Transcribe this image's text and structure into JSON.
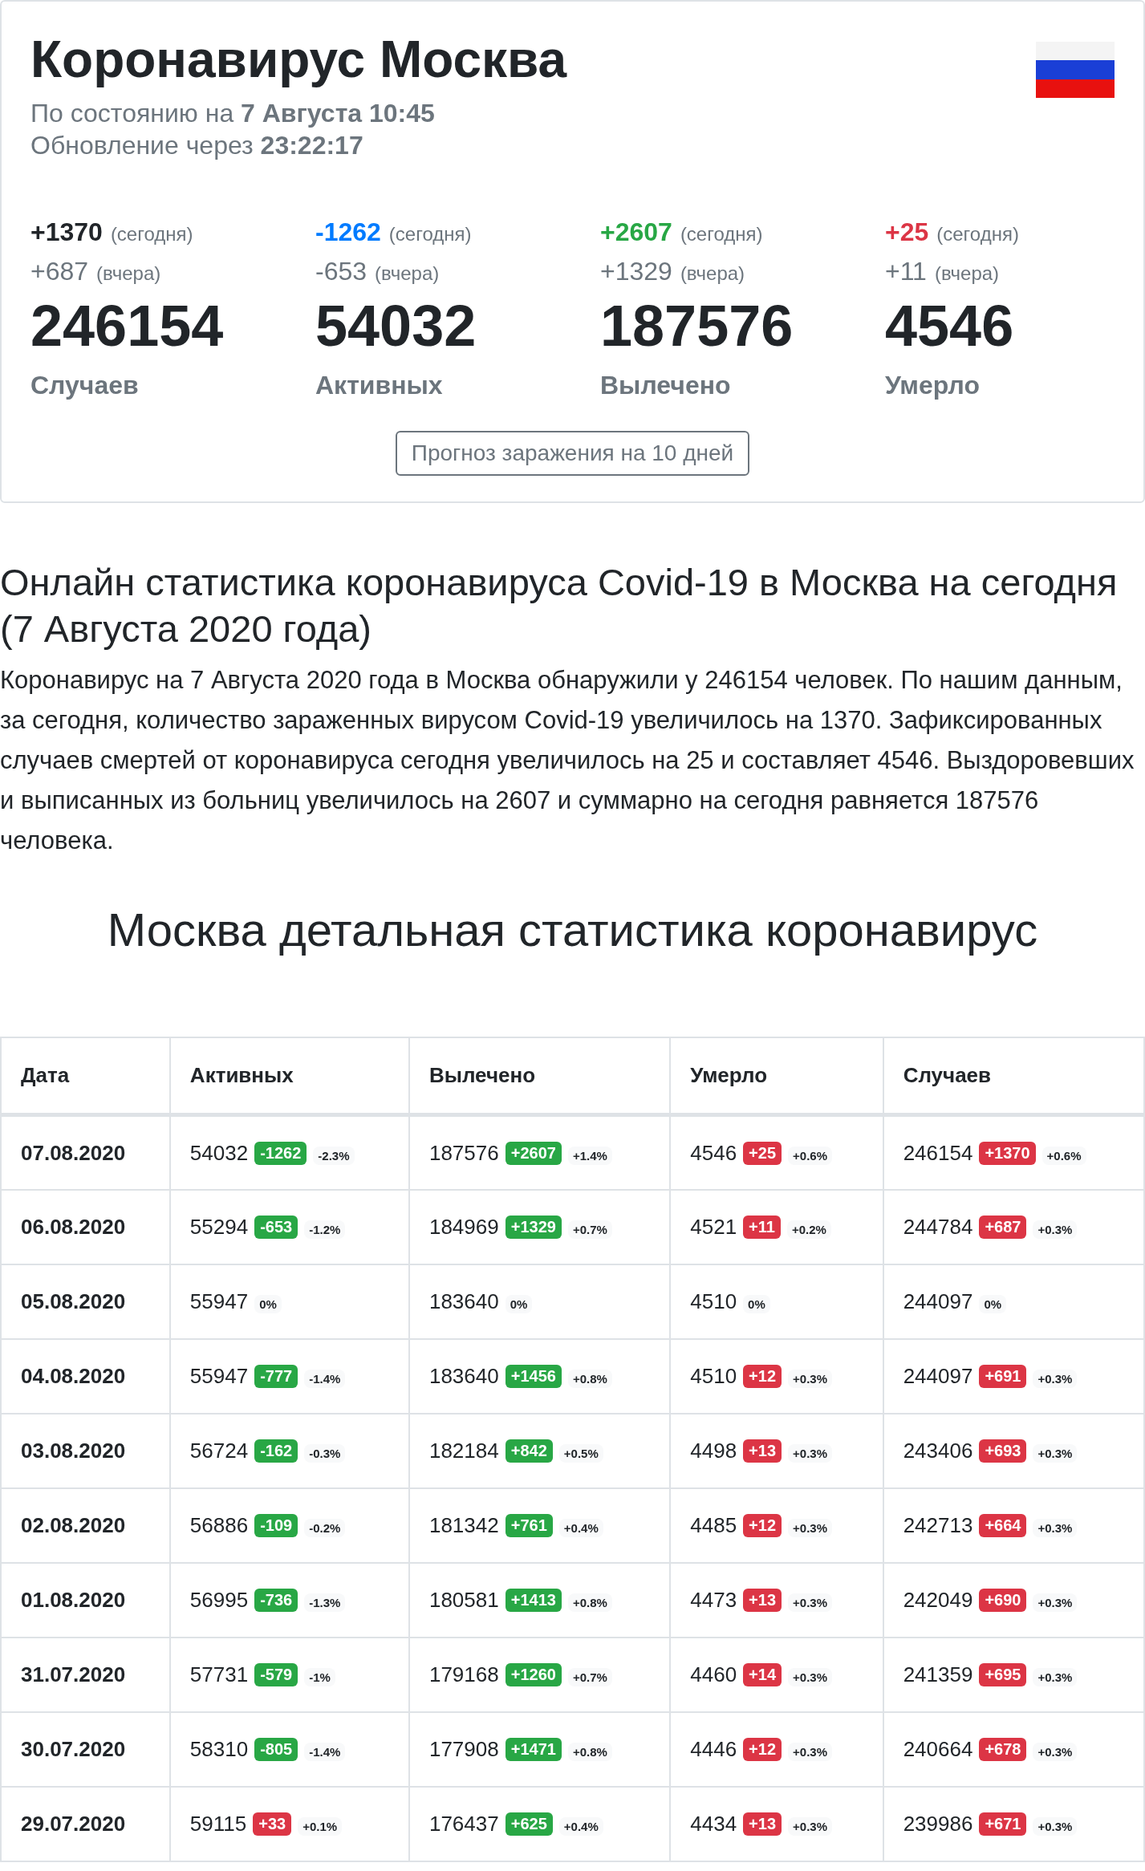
{
  "header": {
    "title": "Коронавирус Москва",
    "as_of": "По состоянию на **7 Августа 10:45**",
    "update": "Обновление через **23:22:17**"
  },
  "stats": [
    {
      "today": "+1370",
      "today_label": "(сегодня)",
      "color": "#212529",
      "yesterday": "+687",
      "yesterday_label": "(вчера)",
      "total": "246154",
      "label": "Случаев"
    },
    {
      "today": "-1262",
      "today_label": "(сегодня)",
      "color": "#007bff",
      "yesterday": "-653",
      "yesterday_label": "(вчера)",
      "total": "54032",
      "label": "Активных"
    },
    {
      "today": "+2607",
      "today_label": "(сегодня)",
      "color": "#28a745",
      "yesterday": "+1329",
      "yesterday_label": "(вчера)",
      "total": "187576",
      "label": "Вылечено"
    },
    {
      "today": "+25",
      "today_label": "(сегодня)",
      "color": "#dc3545",
      "yesterday": "+11",
      "yesterday_label": "(вчера)",
      "total": "4546",
      "label": "Умерло"
    }
  ],
  "forecast_button": "Прогноз заражения на 10 дней",
  "article": {
    "heading": "Онлайн статистика коронавируса Covid-19 в Москва на сегодня (7 Августа 2020 года)",
    "text": "Коронавирус на 7 Августа 2020 года в Москва обнаружили у 246154 человек. По нашим данным, за сегодня, количество зараженных вирусом Covid-19 увеличилось на 1370. Зафиксированных случаев смертей от коронавируса сегодня увеличилось на 25 и составляет 4546. Выздоровевших и выписанных из больниц увеличилось на 2607 и суммарно на сегодня равняется 187576 человека."
  },
  "table_heading": "Москва детальная статистика коронавирус",
  "table": {
    "columns": [
      "Дата",
      "Активных",
      "Вылечено",
      "Умерло",
      "Случаев"
    ],
    "rows": [
      {
        "cells": [
          {
            "kind": "date",
            "value": "07.08.2020"
          },
          {
            "kind": "stat",
            "value": "54032",
            "delta": "-1262",
            "color": "#28a745",
            "pct": "-2.3%"
          },
          {
            "kind": "stat",
            "value": "187576",
            "delta": "+2607",
            "color": "#28a745",
            "pct": "+1.4%"
          },
          {
            "kind": "stat",
            "value": "4546",
            "delta": "+25",
            "color": "#dc3545",
            "pct": "+0.6%"
          },
          {
            "kind": "stat",
            "value": "246154",
            "delta": "+1370",
            "color": "#dc3545",
            "pct": "+0.6%"
          }
        ]
      },
      {
        "cells": [
          {
            "kind": "date",
            "value": "06.08.2020"
          },
          {
            "kind": "stat",
            "value": "55294",
            "delta": "-653",
            "color": "#28a745",
            "pct": "-1.2%"
          },
          {
            "kind": "stat",
            "value": "184969",
            "delta": "+1329",
            "color": "#28a745",
            "pct": "+0.7%"
          },
          {
            "kind": "stat",
            "value": "4521",
            "delta": "+11",
            "color": "#dc3545",
            "pct": "+0.2%"
          },
          {
            "kind": "stat",
            "value": "244784",
            "delta": "+687",
            "color": "#dc3545",
            "pct": "+0.3%"
          }
        ]
      },
      {
        "cells": [
          {
            "kind": "date",
            "value": "05.08.2020"
          },
          {
            "kind": "stat",
            "value": "55947",
            "pct": "0%"
          },
          {
            "kind": "stat",
            "value": "183640",
            "pct": "0%"
          },
          {
            "kind": "stat",
            "value": "4510",
            "pct": "0%"
          },
          {
            "kind": "stat",
            "value": "244097",
            "pct": "0%"
          }
        ]
      },
      {
        "cells": [
          {
            "kind": "date",
            "value": "04.08.2020"
          },
          {
            "kind": "stat",
            "value": "55947",
            "delta": "-777",
            "color": "#28a745",
            "pct": "-1.4%"
          },
          {
            "kind": "stat",
            "value": "183640",
            "delta": "+1456",
            "color": "#28a745",
            "pct": "+0.8%"
          },
          {
            "kind": "stat",
            "value": "4510",
            "delta": "+12",
            "color": "#dc3545",
            "pct": "+0.3%"
          },
          {
            "kind": "stat",
            "value": "244097",
            "delta": "+691",
            "color": "#dc3545",
            "pct": "+0.3%"
          }
        ]
      },
      {
        "cells": [
          {
            "kind": "date",
            "value": "03.08.2020"
          },
          {
            "kind": "stat",
            "value": "56724",
            "delta": "-162",
            "color": "#28a745",
            "pct": "-0.3%"
          },
          {
            "kind": "stat",
            "value": "182184",
            "delta": "+842",
            "color": "#28a745",
            "pct": "+0.5%"
          },
          {
            "kind": "stat",
            "value": "4498",
            "delta": "+13",
            "color": "#dc3545",
            "pct": "+0.3%"
          },
          {
            "kind": "stat",
            "value": "243406",
            "delta": "+693",
            "color": "#dc3545",
            "pct": "+0.3%"
          }
        ]
      },
      {
        "cells": [
          {
            "kind": "date",
            "value": "02.08.2020"
          },
          {
            "kind": "stat",
            "value": "56886",
            "delta": "-109",
            "color": "#28a745",
            "pct": "-0.2%"
          },
          {
            "kind": "stat",
            "value": "181342",
            "delta": "+761",
            "color": "#28a745",
            "pct": "+0.4%"
          },
          {
            "kind": "stat",
            "value": "4485",
            "delta": "+12",
            "color": "#dc3545",
            "pct": "+0.3%"
          },
          {
            "kind": "stat",
            "value": "242713",
            "delta": "+664",
            "color": "#dc3545",
            "pct": "+0.3%"
          }
        ]
      },
      {
        "cells": [
          {
            "kind": "date",
            "value": "01.08.2020"
          },
          {
            "kind": "stat",
            "value": "56995",
            "delta": "-736",
            "color": "#28a745",
            "pct": "-1.3%"
          },
          {
            "kind": "stat",
            "value": "180581",
            "delta": "+1413",
            "color": "#28a745",
            "pct": "+0.8%"
          },
          {
            "kind": "stat",
            "value": "4473",
            "delta": "+13",
            "color": "#dc3545",
            "pct": "+0.3%"
          },
          {
            "kind": "stat",
            "value": "242049",
            "delta": "+690",
            "color": "#dc3545",
            "pct": "+0.3%"
          }
        ]
      },
      {
        "cells": [
          {
            "kind": "date",
            "value": "31.07.2020"
          },
          {
            "kind": "stat",
            "value": "57731",
            "delta": "-579",
            "color": "#28a745",
            "pct": "-1%"
          },
          {
            "kind": "stat",
            "value": "179168",
            "delta": "+1260",
            "color": "#28a745",
            "pct": "+0.7%"
          },
          {
            "kind": "stat",
            "value": "4460",
            "delta": "+14",
            "color": "#dc3545",
            "pct": "+0.3%"
          },
          {
            "kind": "stat",
            "value": "241359",
            "delta": "+695",
            "color": "#dc3545",
            "pct": "+0.3%"
          }
        ]
      },
      {
        "cells": [
          {
            "kind": "date",
            "value": "30.07.2020"
          },
          {
            "kind": "stat",
            "value": "58310",
            "delta": "-805",
            "color": "#28a745",
            "pct": "-1.4%"
          },
          {
            "kind": "stat",
            "value": "177908",
            "delta": "+1471",
            "color": "#28a745",
            "pct": "+0.8%"
          },
          {
            "kind": "stat",
            "value": "4446",
            "delta": "+12",
            "color": "#dc3545",
            "pct": "+0.3%"
          },
          {
            "kind": "stat",
            "value": "240664",
            "delta": "+678",
            "color": "#dc3545",
            "pct": "+0.3%"
          }
        ]
      },
      {
        "cells": [
          {
            "kind": "date",
            "value": "29.07.2020"
          },
          {
            "kind": "stat",
            "value": "59115",
            "delta": "+33",
            "color": "#dc3545",
            "pct": "+0.1%"
          },
          {
            "kind": "stat",
            "value": "176437",
            "delta": "+625",
            "color": "#28a745",
            "pct": "+0.4%"
          },
          {
            "kind": "stat",
            "value": "4434",
            "delta": "+13",
            "color": "#dc3545",
            "pct": "+0.3%"
          },
          {
            "kind": "stat",
            "value": "239986",
            "delta": "+671",
            "color": "#dc3545",
            "pct": "+0.3%"
          }
        ]
      }
    ]
  }
}
